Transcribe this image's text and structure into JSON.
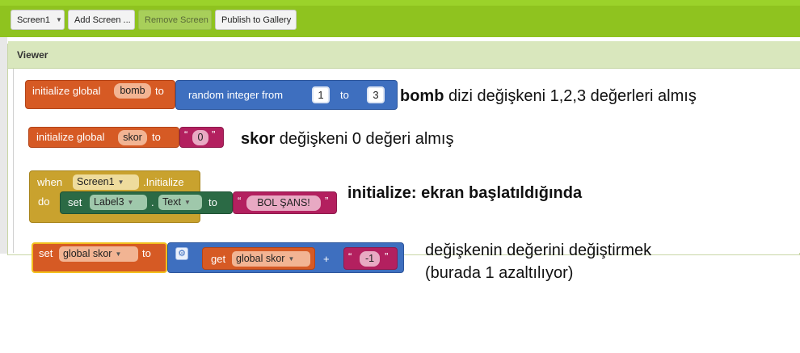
{
  "toolbar": {
    "screen_select": "Screen1",
    "add_screen": "Add Screen ...",
    "remove_screen": "Remove Screen",
    "publish": "Publish to Gallery"
  },
  "viewer": {
    "title": "Viewer"
  },
  "blocks": {
    "b1": {
      "keyword": "initialize global",
      "name": "bomb",
      "to": "to",
      "random": "random integer from",
      "from": "1",
      "to2": "to",
      "upper": "3"
    },
    "b2": {
      "keyword": "initialize global",
      "name": "skor",
      "to": "to",
      "value": "0"
    },
    "b3": {
      "when": "when",
      "component": "Screen1",
      "event": ".Initialize",
      "do": "do",
      "set": "set",
      "label": "Label3",
      "dot": ".",
      "prop": "Text",
      "to": "to",
      "value": "BOL ŞANS!"
    },
    "b4": {
      "set": "set",
      "var": "global skor",
      "to": "to",
      "get": "get",
      "getvar": "global skor",
      "plus": "+",
      "value": "-1"
    }
  },
  "annotations": {
    "a1_bold": "bomb",
    "a1_rest": " dizi değişkeni 1,2,3 değerleri almış",
    "a2_bold": "skor",
    "a2_rest": " değişkeni 0 değeri almış",
    "a3": "initialize: ekran başlatıldığında",
    "a4_line1": "değişkenin değerini değiştirmek",
    "a4_line2": "(burada 1 azaltılıyor)"
  },
  "colors": {
    "variable": "#d65a24",
    "math": "#3e6fbf",
    "text": "#b3205f",
    "event": "#c9a22e",
    "component": "#2b6a45",
    "accent": "#8fc31f"
  }
}
